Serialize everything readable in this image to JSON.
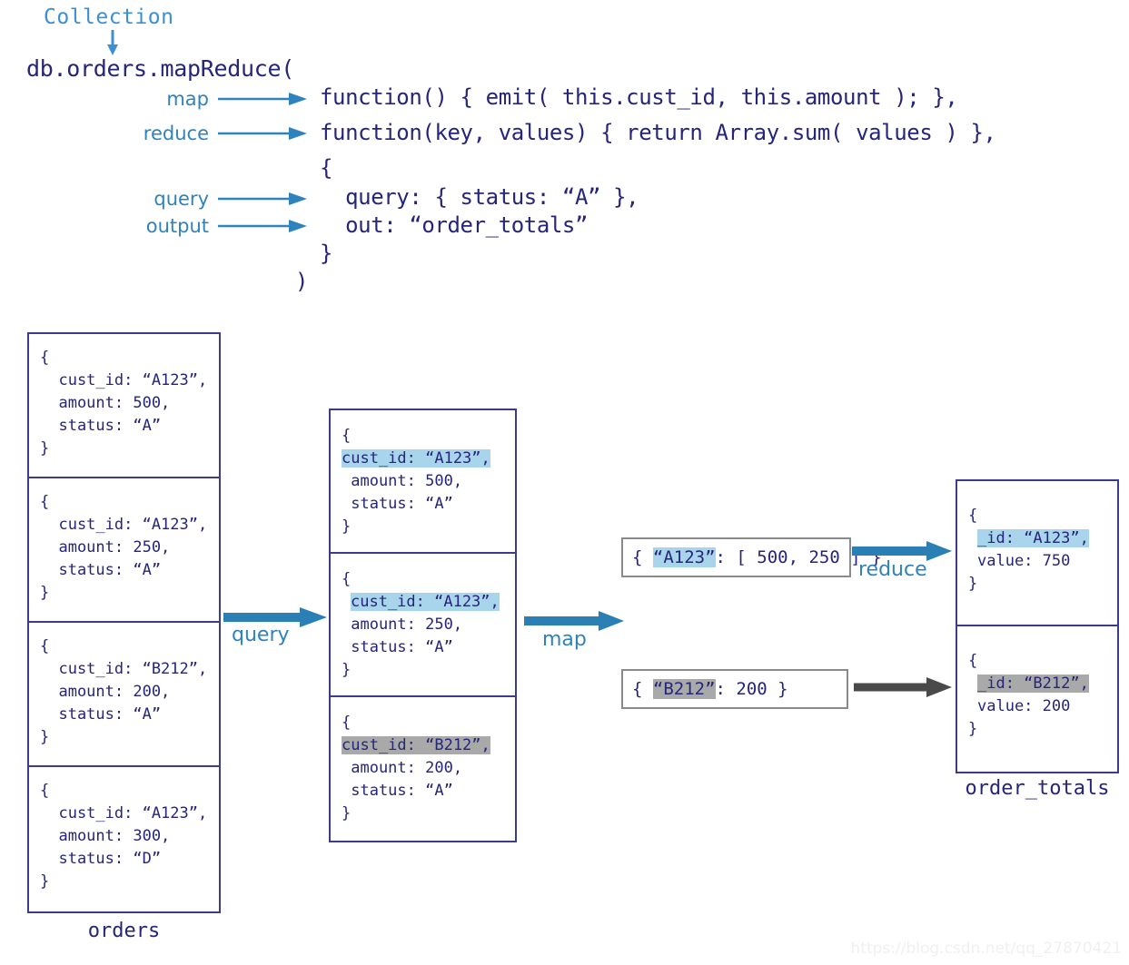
{
  "header": {
    "collection_label": "Collection",
    "call_line": "db.orders.mapReduce(",
    "params": [
      {
        "label": "map"
      },
      {
        "label": "reduce"
      },
      {
        "label": "query"
      },
      {
        "label": "output"
      }
    ],
    "code_lines": [
      "function() { emit( this.cust_id, this.amount ); },",
      "function(key, values) { return Array.sum( values ) },",
      "{",
      "  query: { status: “A” },",
      "  out: “order_totals”",
      "}",
      ")"
    ]
  },
  "orders_box": {
    "caption": "orders",
    "documents": [
      {
        "open": "{",
        "fields": [
          "  cust_id: “A123”,",
          "  amount: 500,",
          "  status: “A”"
        ],
        "close": "}"
      },
      {
        "open": "{",
        "fields": [
          "  cust_id: “A123”,",
          "  amount: 250,",
          "  status: “A”"
        ],
        "close": "}"
      },
      {
        "open": "{",
        "fields": [
          "  cust_id: “B212”,",
          "  amount: 200,",
          "  status: “A”"
        ],
        "close": "}"
      },
      {
        "open": "{",
        "fields": [
          "  cust_id: “A123”,",
          "  amount: 300,",
          "  status: “D”"
        ],
        "close": "}"
      }
    ]
  },
  "queried_box": {
    "documents": [
      {
        "open": "{",
        "key_line": "cust_id: “A123”,",
        "key_highlight": "blue",
        "key_indent": 0,
        "fields": [
          " amount: 500,",
          " status: “A”"
        ],
        "close": "}"
      },
      {
        "open": "{",
        "key_line": "cust_id: “A123”,",
        "key_highlight": "blue",
        "key_indent": 10,
        "fields": [
          " amount: 250,",
          " status: “A”"
        ],
        "close": "}"
      },
      {
        "open": "{",
        "key_line": "cust_id: “B212”,",
        "key_highlight": "gray",
        "key_indent": 0,
        "fields": [
          " amount: 200,",
          " status: “A”"
        ],
        "close": "}"
      }
    ]
  },
  "intermediate": [
    {
      "prefix": "{ ",
      "key": "“A123”",
      "highlight": "blue",
      "rest": ": [ 500, 250 ] }"
    },
    {
      "prefix": "{ ",
      "key": "“B212”",
      "highlight": "gray",
      "rest": ": 200 }"
    }
  ],
  "output_box": {
    "caption": "order_totals",
    "documents": [
      {
        "open": "{",
        "key_line": "_id: “A123”,",
        "key_highlight": "blue",
        "fields": [
          "value: 750"
        ],
        "close": "}"
      },
      {
        "open": "{",
        "key_line": "_id: “B212”,",
        "key_highlight": "gray",
        "fields": [
          "value: 200"
        ],
        "close": "}"
      }
    ]
  },
  "flow_labels": {
    "query": "query",
    "map": "map",
    "reduce": "reduce"
  },
  "colors": {
    "text_navy": "#26257a",
    "accent_blue": "#2e83bd",
    "light_blue_label": "#3d8fd1",
    "highlight_blue": "#a9d5ec",
    "highlight_gray": "#a9a9a9",
    "box_border_navy": "#3c3b8c",
    "box_border_gray": "#8a8a8a",
    "arrow_dark": "#4a4a4a"
  },
  "watermark": "https://blog.csdn.net/qq_27870421"
}
